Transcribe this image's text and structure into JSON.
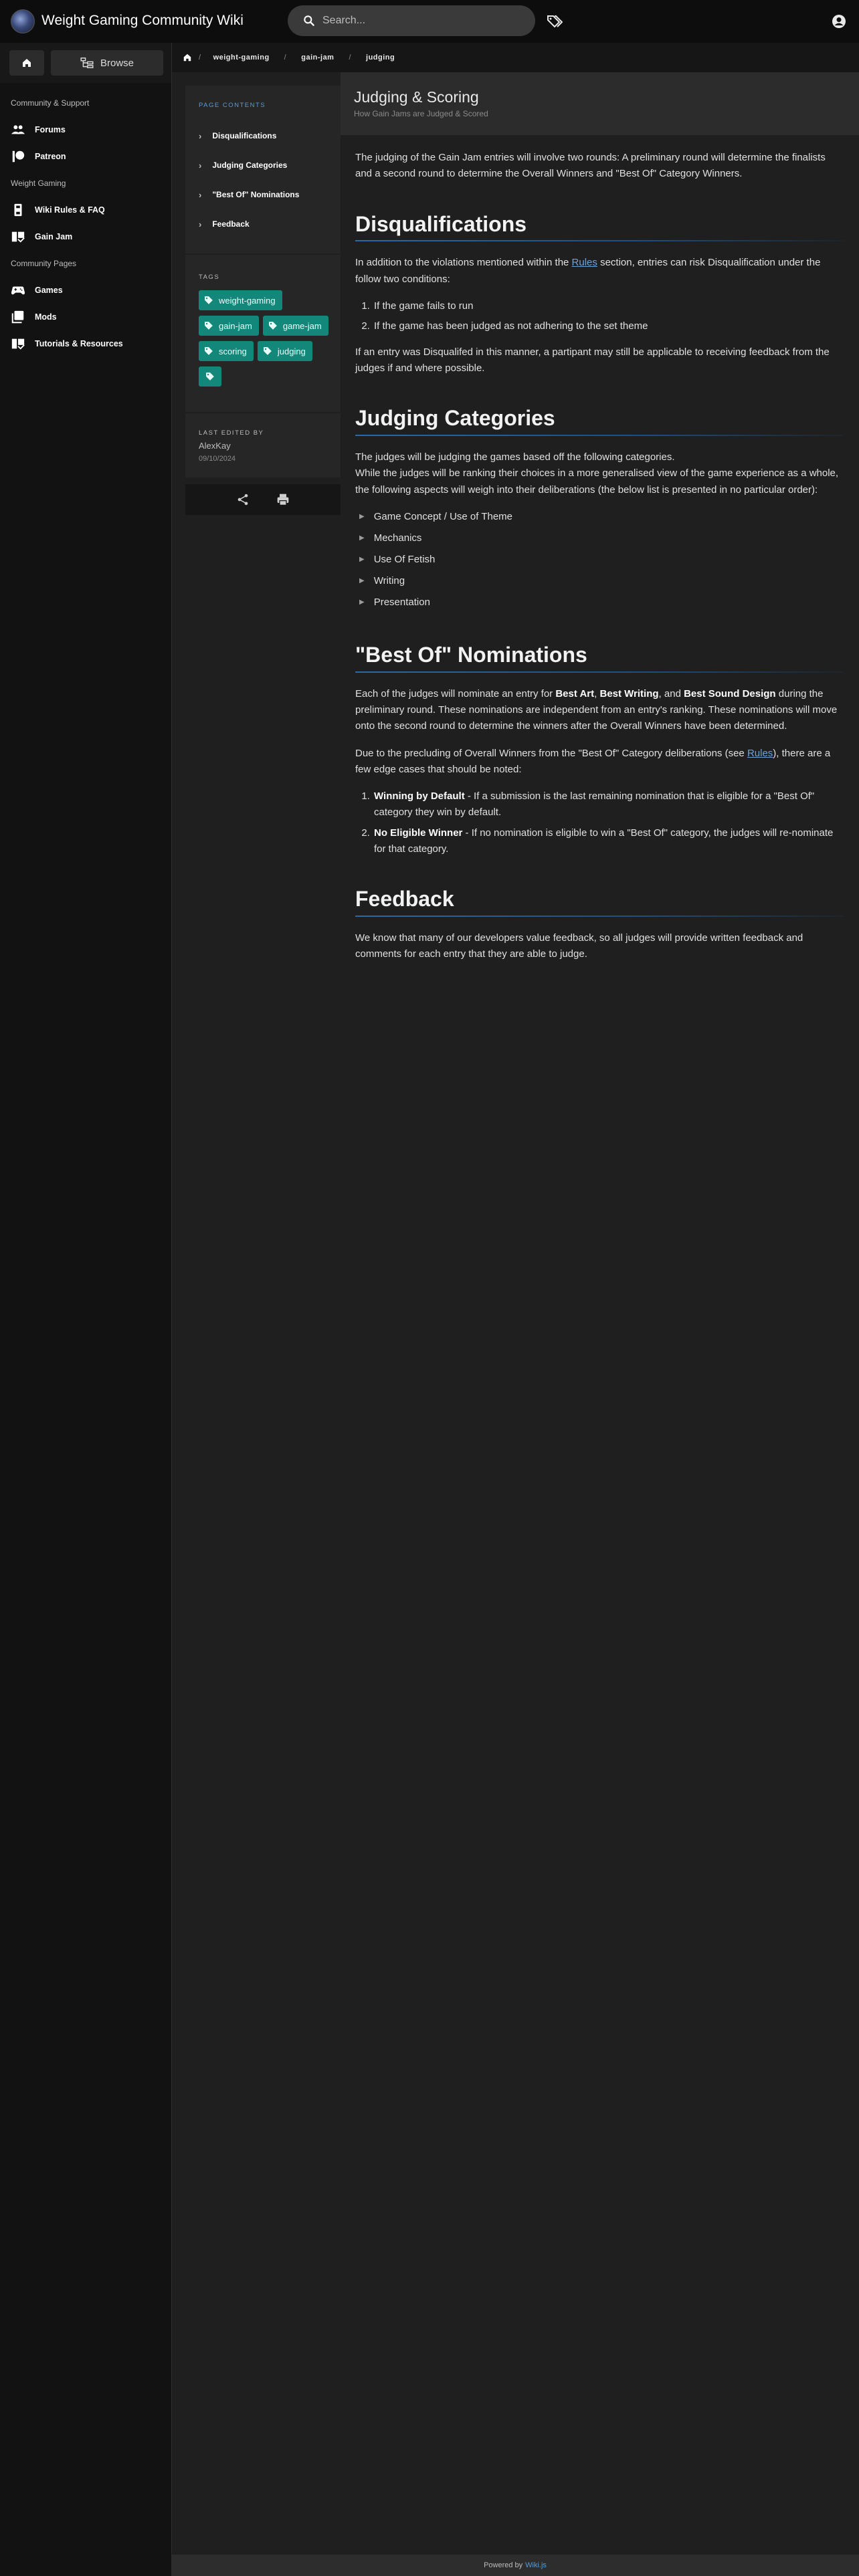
{
  "header": {
    "site_title": "Weight Gaming Community Wiki",
    "search_placeholder": "Search..."
  },
  "sidebar": {
    "browse_label": "Browse",
    "sections": [
      {
        "header": "Community & Support",
        "items": [
          {
            "label": "Forums",
            "icon": "users-icon"
          },
          {
            "label": "Patreon",
            "icon": "patreon-icon"
          }
        ]
      },
      {
        "header": "Weight Gaming",
        "items": [
          {
            "label": "Wiki Rules & FAQ",
            "icon": "book-icon"
          },
          {
            "label": "Gain Jam",
            "icon": "book-open-icon"
          }
        ]
      },
      {
        "header": "Community Pages",
        "items": [
          {
            "label": "Games",
            "icon": "gamepad-icon"
          },
          {
            "label": "Mods",
            "icon": "library-icon"
          },
          {
            "label": "Tutorials & Resources",
            "icon": "book-open-icon"
          }
        ]
      }
    ]
  },
  "breadcrumb": [
    "weight-gaming",
    "gain-jam",
    "judging"
  ],
  "toc": {
    "title": "PAGE CONTENTS",
    "items": [
      "Disqualifications",
      "Judging Categories",
      "\"Best Of\" Nominations",
      "Feedback"
    ]
  },
  "tags": {
    "title": "TAGS",
    "items": [
      "weight-gaming",
      "gain-jam",
      "game-jam",
      "scoring",
      "judging"
    ]
  },
  "last_edited": {
    "title": "LAST EDITED BY",
    "author": "AlexKay",
    "date": "09/10/2024"
  },
  "page": {
    "title": "Judging & Scoring",
    "subtitle": "How Gain Jams are Judged & Scored"
  },
  "article": {
    "intro": "The judging of the Gain Jam entries will involve two rounds: A preliminary round will determine the finalists and a second round to determine the Overall Winners and \"Best Of\" Category Winners.",
    "disq": {
      "heading": "Disqualifications",
      "p1_before": "In addition to the violations mentioned within the ",
      "p1_link": "Rules",
      "p1_after": " section, entries can risk Disqualification under the follow two conditions:",
      "conditions": [
        "If the game fails to run",
        "If the game has been judged as not adhering to the set theme"
      ],
      "p2": "If an entry was Disqualifed in this manner, a partipant may still be applicable to receiving feedback from the judges if and where possible."
    },
    "cats": {
      "heading": "Judging Categories",
      "p1a": "The judges will be judging the games based off the following categories.",
      "p1b": "While the judges will be ranking their choices in a more generalised view of the game experience as a whole, the following aspects will weigh into their deliberations (the below list is presented in no particular order):",
      "items": [
        "Game Concept / Use of Theme",
        "Mechanics",
        "Use Of Fetish",
        "Writing",
        "Presentation"
      ]
    },
    "bestof": {
      "heading": "\"Best Of\" Nominations",
      "p1_a": "Each of the judges will nominate an entry for ",
      "p1_art": "Best Art",
      "p1_b": ", ",
      "p1_writing": "Best Writing",
      "p1_c": ", and ",
      "p1_sound": "Best Sound Design",
      "p1_d": " during the preliminary round. These nominations are independent from an entry's ranking. These nominations will move onto the second round to determine the winners after the Overall Winners have been determined.",
      "p2_before": "Due to the precluding of Overall Winners from the \"Best Of\" Category deliberations (see ",
      "p2_link": "Rules",
      "p2_after": "), there are a few edge cases that should be noted:",
      "case1_title": "Winning by Default",
      "case1_text": " - If a submission is the last remaining nomination that is eligible for a \"Best Of\" category they win by default.",
      "case2_title": "No Eligible Winner",
      "case2_text": " - If no nomination is eligible to win a \"Best Of\" category, the judges will re-nominate for that category."
    },
    "feedback": {
      "heading": "Feedback",
      "p1": "We know that many of our developers value feedback, so all judges will provide written feedback and comments for each entry that they are able to judge."
    }
  },
  "footer": {
    "powered_by": "Powered by",
    "engine": "Wiki.js"
  },
  "colors": {
    "accent": "#5a9bd5",
    "tag": "#13877a",
    "link": "#6fa3d8"
  }
}
